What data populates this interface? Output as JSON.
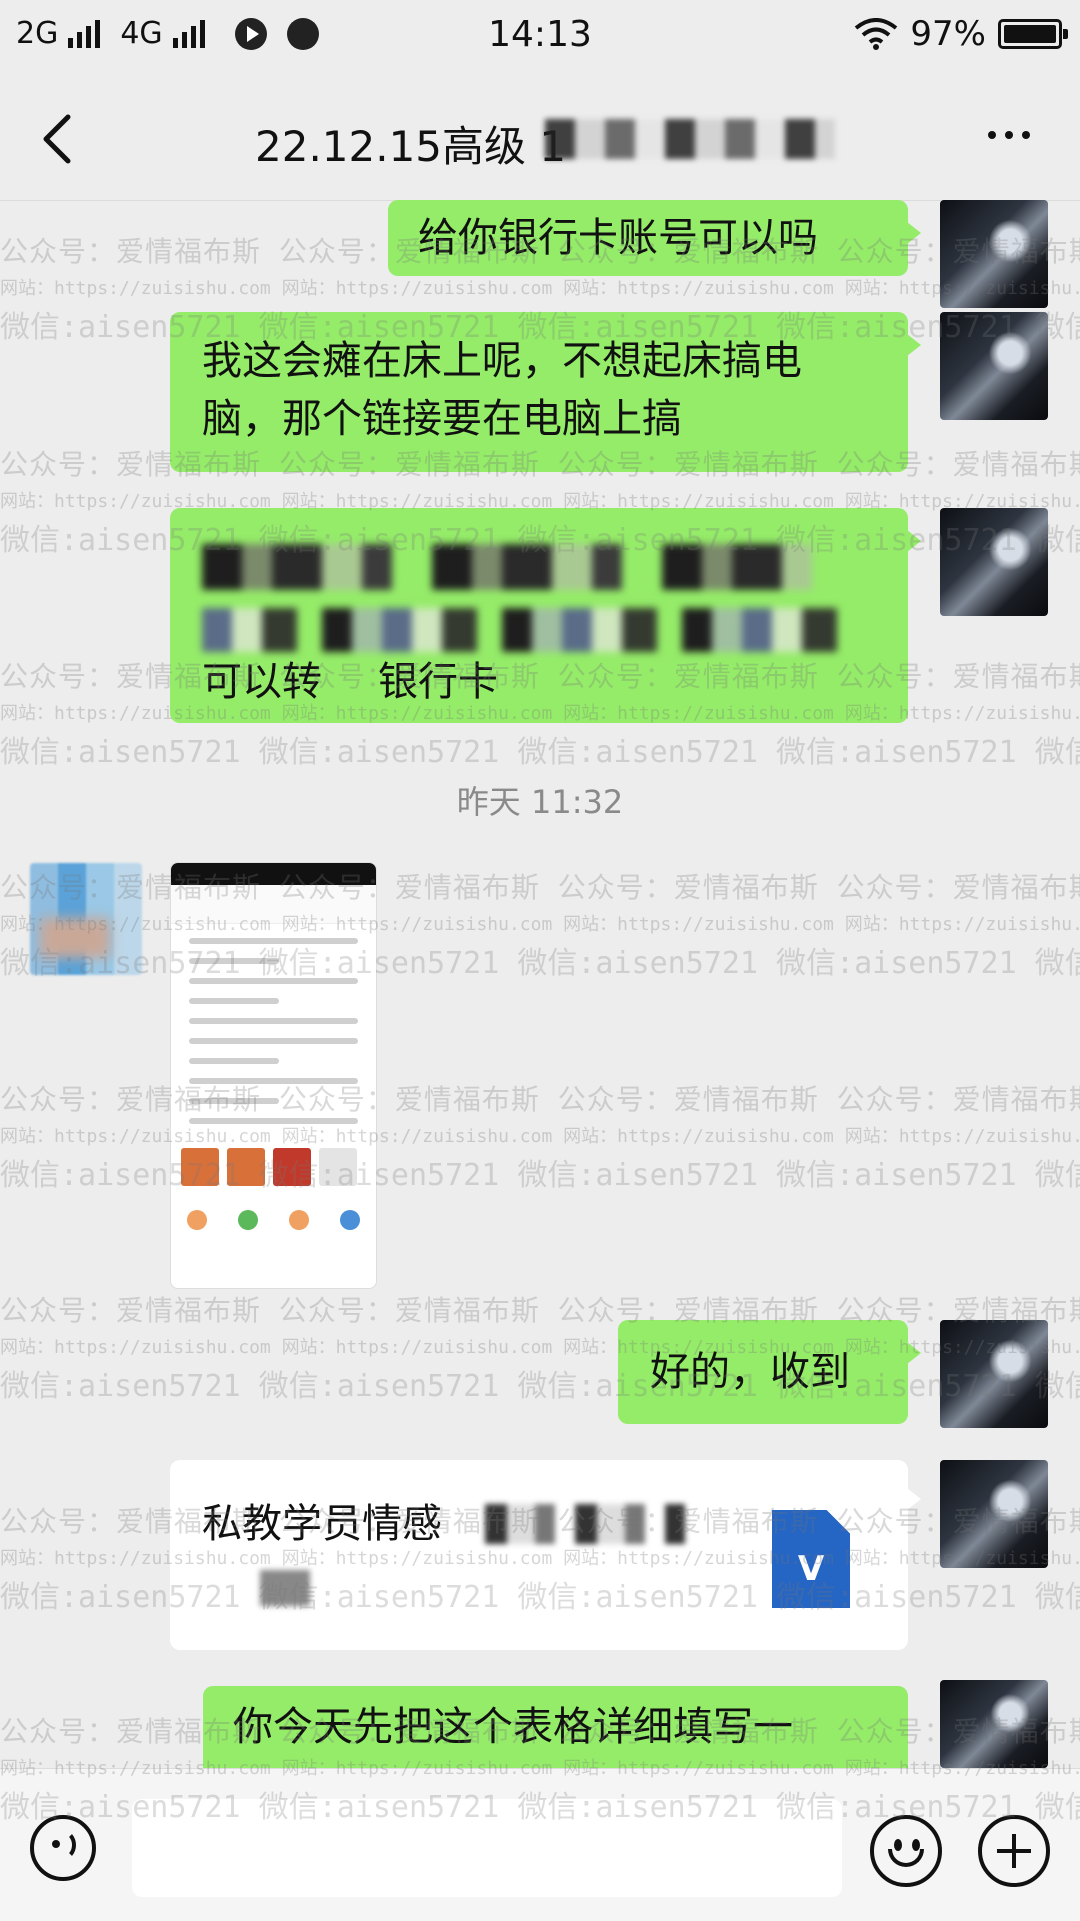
{
  "status_bar": {
    "network_1": "2G",
    "network_2": "4G",
    "time": "14:13",
    "battery": "97%"
  },
  "nav": {
    "title": "22.12.15高级 1",
    "back_icon": "chevron-left-icon",
    "more_icon": "ellipsis-icon"
  },
  "messages": {
    "m1": "给你银行卡账号可以吗",
    "m2_line1": "我这会瘫在床上呢，不想起床搞电",
    "m2_line2": "脑，那个链接要在电脑上搞",
    "m3_tail": "可以转",
    "m3_tail2": "银行卡",
    "timestamp": "昨天 11:32",
    "m4": "好的，收到",
    "file_title": "私教学员情感",
    "file_icon_letter": "V",
    "m5": "你今天先把这个表格详细填写一"
  },
  "watermark": {
    "line1": "公众号：爱情福布斯 公众号：爱情福布斯 公众号：爱情福布斯 公众号：爱情福布斯 公众号：爱情福布斯",
    "line2": "网站：https://zuisishu.com 网站：https://zuisishu.com 网站：https://zuisishu.com 网站：https://zuisishu.com",
    "line3": "微信:aisen5721 微信:aisen5721 微信:aisen5721 微信:aisen5721 微信:aisen5721"
  },
  "colors": {
    "bubble_me": "#95ec69",
    "background": "#ededed",
    "file_icon": "#2565c4"
  }
}
